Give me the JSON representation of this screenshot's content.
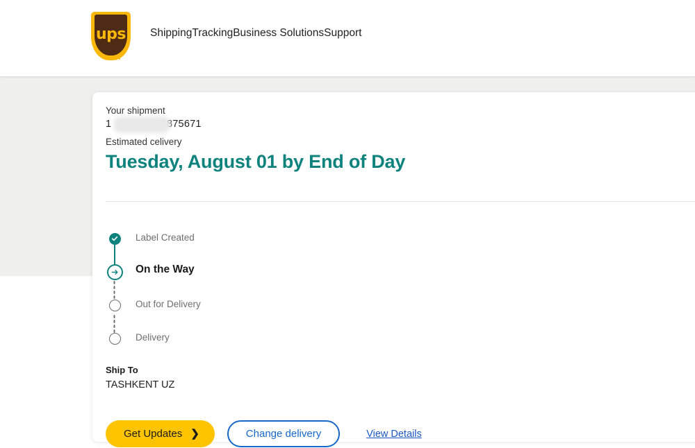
{
  "header": {
    "logo_text": "ups",
    "logo_name": "ups-shield-logo",
    "nav": [
      {
        "label": "Shipping"
      },
      {
        "label": "Tracking"
      },
      {
        "label": "Business Solutions"
      },
      {
        "label": "Support"
      }
    ]
  },
  "shipment": {
    "your_shipment_label": "Your shipment",
    "tracking_number": "1             796875671",
    "tracking_number_redacted": true,
    "estimated_delivery_label": "Estimated celivery",
    "estimated_delivery_value": "Tuesday, August 01 by End of Day"
  },
  "progress": {
    "steps": [
      {
        "label": "Label Created",
        "state": "done",
        "icon": "check-icon"
      },
      {
        "label": "On the Way",
        "state": "current",
        "icon": "arrow-right-icon"
      },
      {
        "label": "Out for Delivery",
        "state": "pending",
        "icon": "circle-outline-icon"
      },
      {
        "label": "Delivery",
        "state": "pending",
        "icon": "circle-outline-icon"
      }
    ]
  },
  "ship_to": {
    "label": "Ship To",
    "value": "TASHKENT UZ"
  },
  "actions": {
    "primary_label": "Get Updates",
    "primary_chevron": "❯",
    "secondary_label": "Change delivery",
    "details_link_label": "View Details"
  },
  "colors": {
    "ups_gold": "#FAB80A",
    "ups_brown": "#4E2B14",
    "button_gold": "#FFC400",
    "teal": "#0E837E",
    "link_blue": "#1A56C4",
    "border_blue": "#1668C8",
    "page_grey": "#EFEFED"
  }
}
